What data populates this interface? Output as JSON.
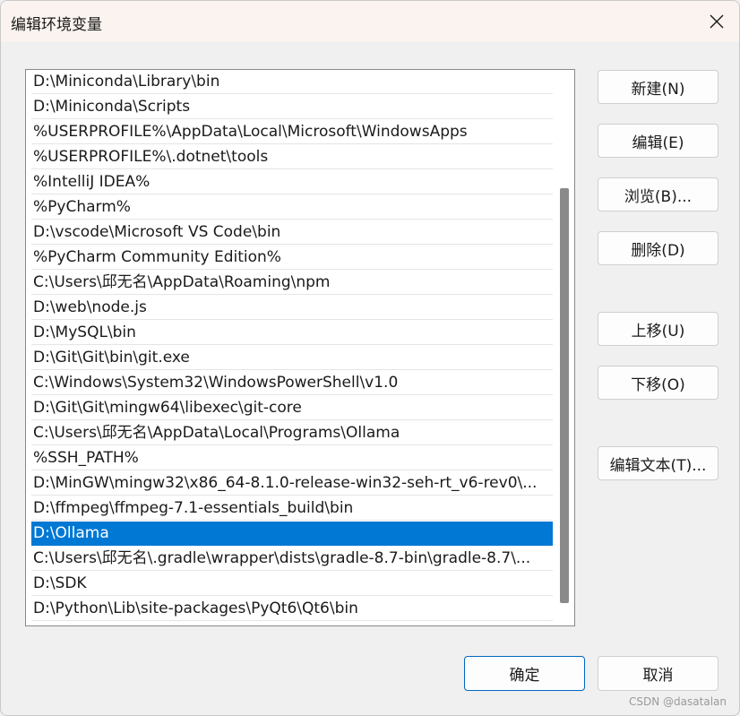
{
  "window": {
    "title": "编辑环境变量",
    "close_icon": "close-icon"
  },
  "paths": [
    "D:\\Miniconda\\Library\\bin",
    "D:\\Miniconda\\Scripts",
    "%USERPROFILE%\\AppData\\Local\\Microsoft\\WindowsApps",
    "%USERPROFILE%\\.dotnet\\tools",
    "%IntelliJ IDEA%",
    "%PyCharm%",
    "D:\\vscode\\Microsoft VS Code\\bin",
    "%PyCharm Community Edition%",
    "C:\\Users\\邱无名\\AppData\\Roaming\\npm",
    "D:\\web\\node.js",
    "D:\\MySQL\\bin",
    "D:\\Git\\Git\\bin\\git.exe",
    "C:\\Windows\\System32\\WindowsPowerShell\\v1.0",
    "D:\\Git\\Git\\mingw64\\libexec\\git-core",
    "C:\\Users\\邱无名\\AppData\\Local\\Programs\\Ollama",
    "%SSH_PATH%",
    "D:\\MinGW\\mingw32\\x86_64-8.1.0-release-win32-seh-rt_v6-rev0\\...",
    "D:\\ffmpeg\\ffmpeg-7.1-essentials_build\\bin",
    "D:\\Ollama",
    "C:\\Users\\邱无名\\.gradle\\wrapper\\dists\\gradle-8.7-bin\\gradle-8.7\\...",
    "D:\\SDK",
    "D:\\Python\\Lib\\site-packages\\PyQt6\\Qt6\\bin"
  ],
  "selected_path": "D:\\Ollama",
  "buttons": {
    "new": "新建(N)",
    "edit": "编辑(E)",
    "browse": "浏览(B)...",
    "delete": "删除(D)",
    "move_up": "上移(U)",
    "move_down": "下移(O)",
    "edit_text": "编辑文本(T)...",
    "ok": "确定",
    "cancel": "取消"
  },
  "watermark": "CSDN @dasatalan",
  "colors": {
    "selection": "#0078d4",
    "accent_border": "#0067c0",
    "title_bar": "#fbf3ef"
  }
}
